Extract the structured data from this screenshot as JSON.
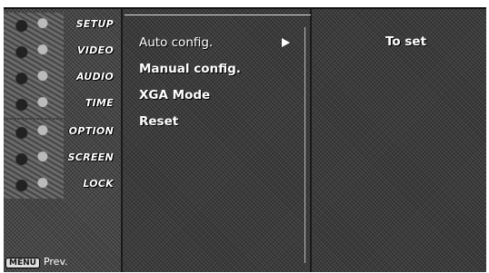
{
  "sidebar": {
    "categories": [
      {
        "label": "SETUP",
        "icon": "setup-icon"
      },
      {
        "label": "VIDEO",
        "icon": "video-icon"
      },
      {
        "label": "AUDIO",
        "icon": "audio-icon"
      },
      {
        "label": "TIME",
        "icon": "time-icon"
      },
      {
        "label": "OPTION",
        "icon": "option-icon"
      },
      {
        "label": "SCREEN",
        "icon": "screen-icon"
      },
      {
        "label": "LOCK",
        "icon": "lock-icon"
      }
    ],
    "prev_key": "MENU",
    "prev_label": "Prev."
  },
  "submenu": {
    "items": [
      {
        "label": "Auto config."
      },
      {
        "label": "Manual config."
      },
      {
        "label": "XGA Mode"
      },
      {
        "label": "Reset"
      }
    ],
    "arrow_icon": "right-triangle-icon"
  },
  "detail": {
    "hint": "To set"
  }
}
